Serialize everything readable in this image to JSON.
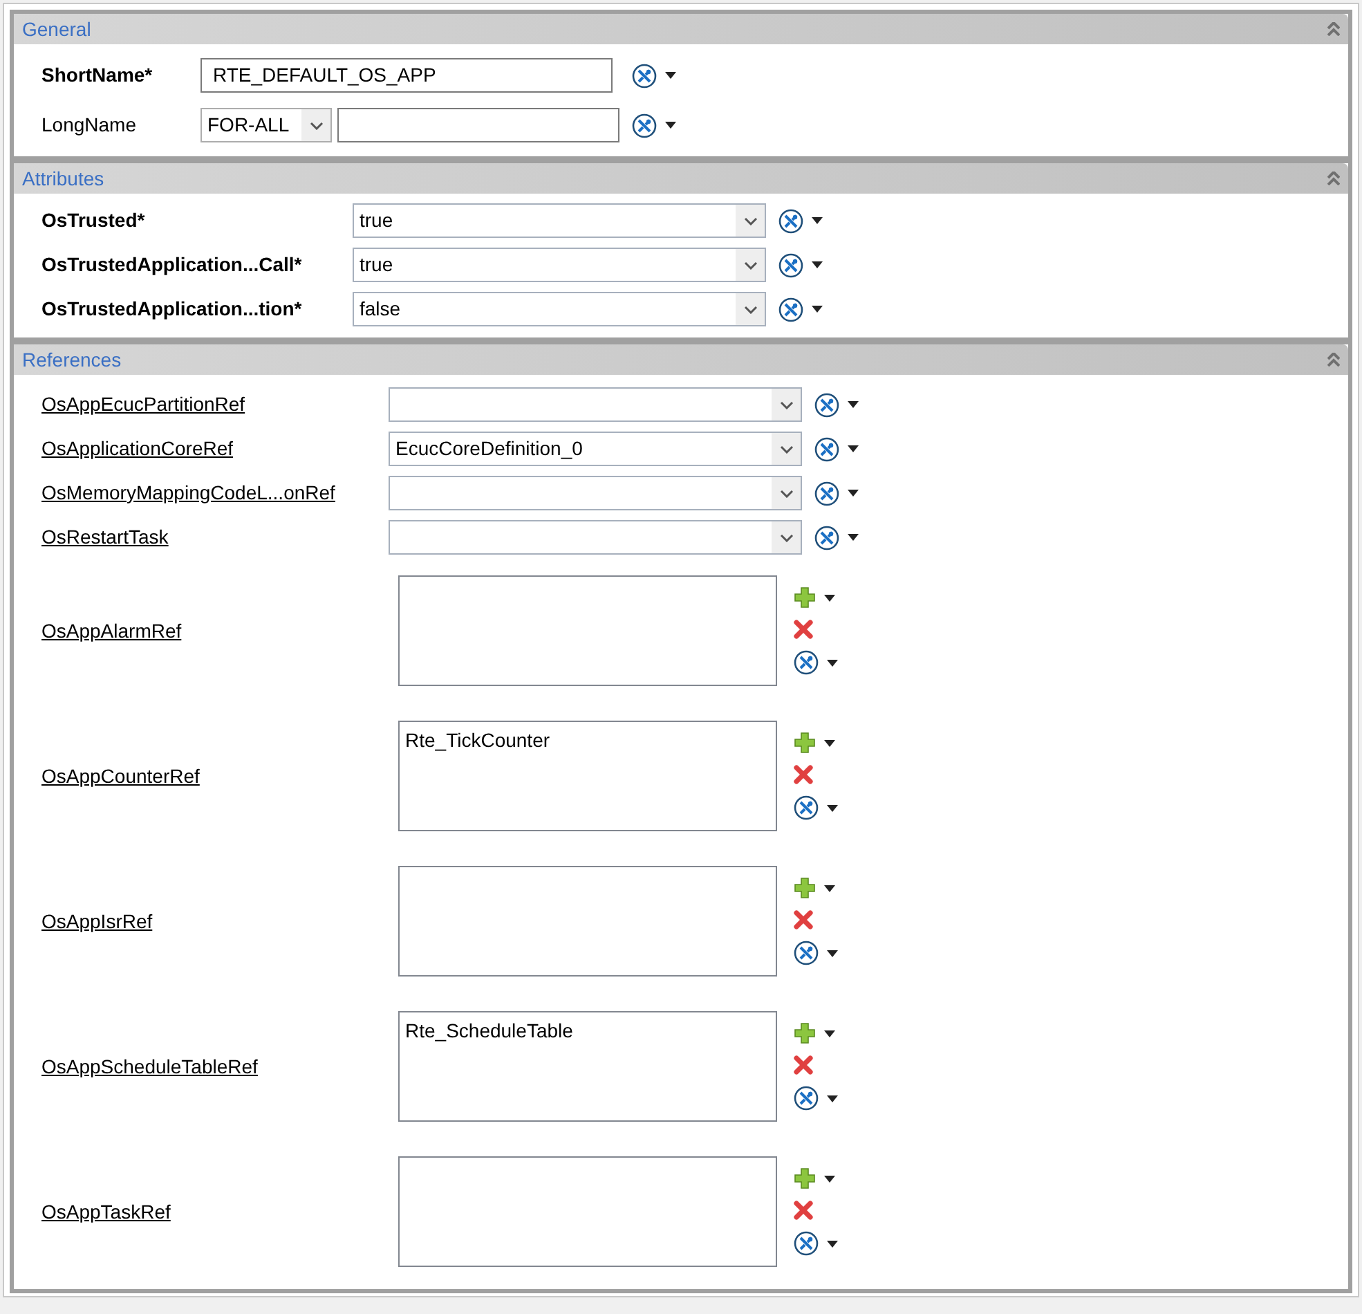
{
  "general": {
    "title": "General",
    "short_name": {
      "label": "ShortName*",
      "value": "RTE_DEFAULT_OS_APP"
    },
    "long_name": {
      "label": "LongName",
      "language": "FOR-ALL"
    }
  },
  "attributes": {
    "title": "Attributes",
    "rows": [
      {
        "label": "OsTrusted*",
        "value": "true"
      },
      {
        "label": "OsTrustedApplication...Call*",
        "value": "true"
      },
      {
        "label": "OsTrustedApplication...tion*",
        "value": "false"
      }
    ]
  },
  "references": {
    "title": "References",
    "rows": [
      {
        "kind": "combo",
        "label": "OsAppEcucPartitionRef"
      },
      {
        "kind": "combo",
        "label": "OsApplicationCoreRef",
        "value": "EcucCoreDefinition_0"
      },
      {
        "kind": "combo",
        "label": "OsMemoryMappingCodeL...onRef"
      },
      {
        "kind": "combo",
        "label": "OsRestartTask"
      },
      {
        "kind": "list",
        "label": "OsAppAlarmRef"
      },
      {
        "kind": "list",
        "label": "OsAppCounterRef",
        "items": [
          "Rte_TickCounter"
        ]
      },
      {
        "kind": "list",
        "label": "OsAppIsrRef"
      },
      {
        "kind": "list",
        "label": "OsAppScheduleTableRef",
        "items": [
          "Rte_ScheduleTable"
        ]
      },
      {
        "kind": "list",
        "label": "OsAppTaskRef"
      }
    ]
  }
}
